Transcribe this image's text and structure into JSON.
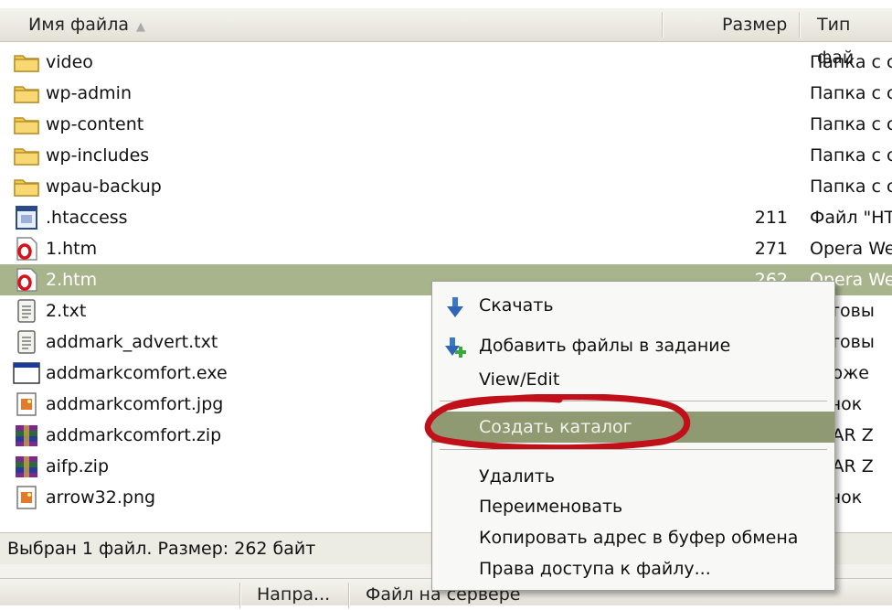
{
  "header": {
    "name_label": "Имя файла",
    "sort_indicator": "▲",
    "size_label": "Размер",
    "type_label": "Тип фай"
  },
  "files": [
    {
      "name": "video",
      "size": "",
      "type": "Папка с с",
      "icon": "folder-icon"
    },
    {
      "name": "wp-admin",
      "size": "",
      "type": "Папка с с",
      "icon": "folder-icon"
    },
    {
      "name": "wp-content",
      "size": "",
      "type": "Папка с с",
      "icon": "folder-icon"
    },
    {
      "name": "wp-includes",
      "size": "",
      "type": "Папка с с",
      "icon": "folder-icon"
    },
    {
      "name": "wpau-backup",
      "size": "",
      "type": "Папка с с",
      "icon": "folder-icon"
    },
    {
      "name": ".htaccess",
      "size": "211",
      "type": "Файл \"HT",
      "icon": "config-file-icon"
    },
    {
      "name": "1.htm",
      "size": "271",
      "type": "Opera We",
      "icon": "opera-file-icon"
    },
    {
      "name": "2.htm",
      "size": "262",
      "type": "Opera We",
      "icon": "opera-file-icon",
      "selected": true
    },
    {
      "name": "2.txt",
      "size": "",
      "type": "кстовы",
      "icon": "text-file-icon"
    },
    {
      "name": "addmark_advert.txt",
      "size": "",
      "type": "кстовы",
      "icon": "text-file-icon"
    },
    {
      "name": "addmarkcomfort.exe",
      "size": "",
      "type": "иложе",
      "icon": "exe-file-icon"
    },
    {
      "name": "addmarkcomfort.jpg",
      "size": "",
      "type": "сунок ",
      "icon": "image-file-icon"
    },
    {
      "name": "addmarkcomfort.zip",
      "size": "",
      "type": "nRAR Z",
      "icon": "archive-file-icon"
    },
    {
      "name": "aifp.zip",
      "size": "",
      "type": "nRAR Z",
      "icon": "archive-file-icon"
    },
    {
      "name": "arrow32.png",
      "size": "",
      "type": "сунок ",
      "icon": "image-file-icon"
    }
  ],
  "context_menu": {
    "items": [
      {
        "label": "Скачать",
        "icon": "download-arrow-icon"
      },
      {
        "label": "Добавить файлы в задание",
        "icon": "add-to-queue-icon"
      },
      {
        "label": "View/Edit"
      },
      {
        "label": "Создать каталог",
        "active": true,
        "annotated": true
      },
      {
        "label": "Удалить"
      },
      {
        "label": "Переименовать"
      },
      {
        "label": "Копировать адрес в буфер обмена"
      },
      {
        "label": "Права доступа к файлу..."
      }
    ]
  },
  "status": {
    "text": "Выбран 1 файл. Размер: 262 байт"
  },
  "bottom_header": {
    "direction_label": "Напра...",
    "server_file_label": "Файл на сервере"
  },
  "colors": {
    "selection": "#a8b48c",
    "menu_active": "#8f9a73",
    "annotation": "#c0101a",
    "folder": "#f0c850"
  }
}
